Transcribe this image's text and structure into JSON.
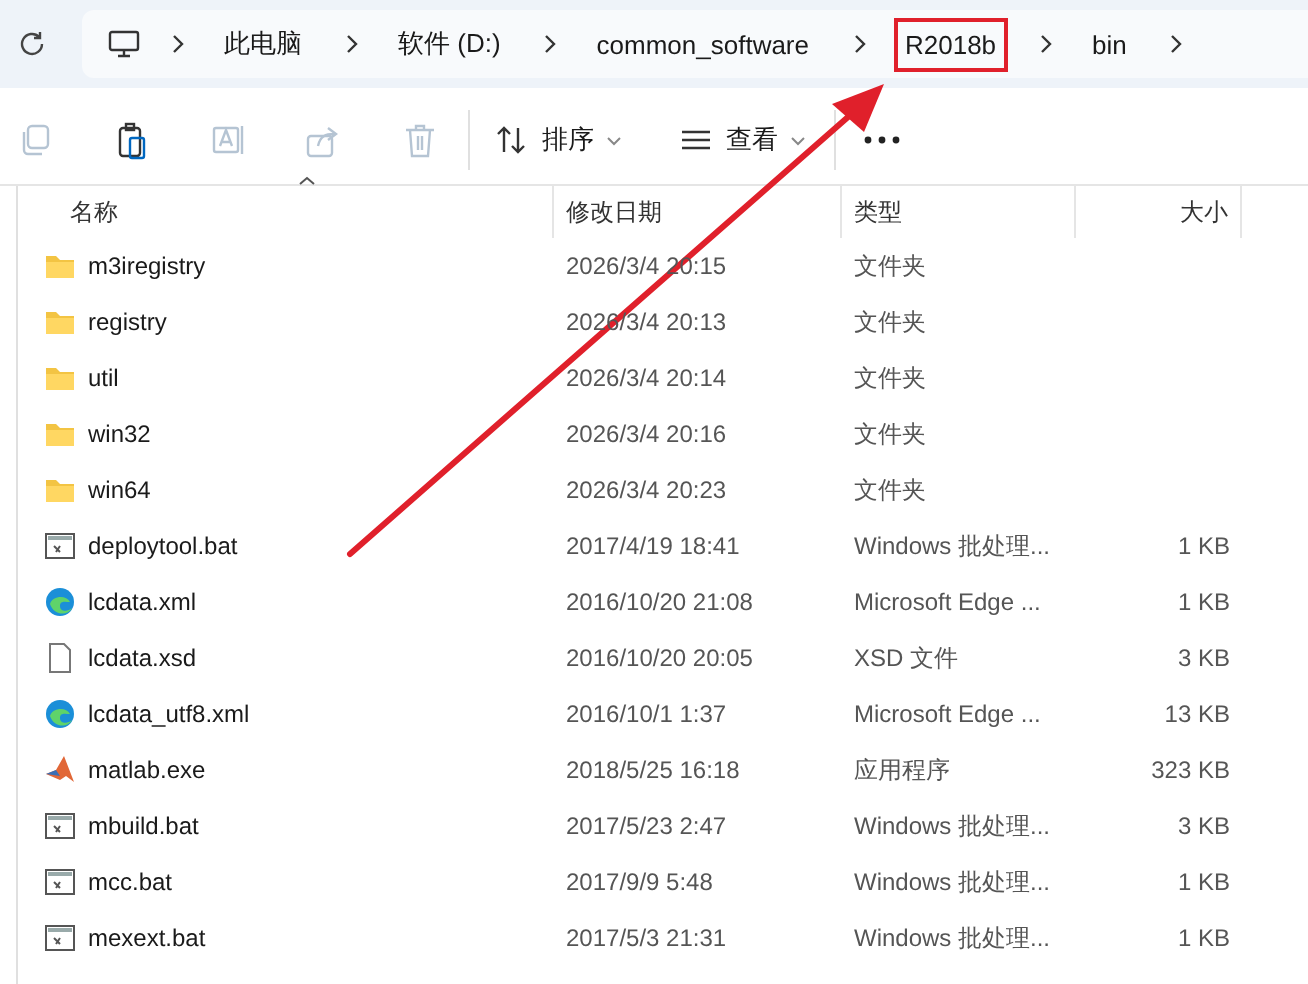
{
  "breadcrumb": [
    {
      "label": "此电脑",
      "highlighted": false
    },
    {
      "label": "软件 (D:)",
      "highlighted": false
    },
    {
      "label": "common_software",
      "highlighted": false
    },
    {
      "label": "R2018b",
      "highlighted": true
    },
    {
      "label": "bin",
      "highlighted": false
    }
  ],
  "toolbar": {
    "actions": [
      {
        "kind": "copy",
        "disabled": true
      },
      {
        "kind": "paste",
        "disabled": false
      },
      {
        "kind": "rename",
        "disabled": true
      },
      {
        "kind": "share",
        "disabled": true
      },
      {
        "kind": "delete",
        "disabled": true
      }
    ],
    "sort_label": "排序",
    "view_label": "查看"
  },
  "table": {
    "columns": [
      "名称",
      "修改日期",
      "类型",
      "大小"
    ],
    "rows": [
      {
        "kind": "folder",
        "name": "m3iregistry",
        "date": "2026/3/4 20:15",
        "type": "文件夹",
        "size": ""
      },
      {
        "kind": "folder",
        "name": "registry",
        "date": "2026/3/4 20:13",
        "type": "文件夹",
        "size": ""
      },
      {
        "kind": "folder",
        "name": "util",
        "date": "2026/3/4 20:14",
        "type": "文件夹",
        "size": ""
      },
      {
        "kind": "folder",
        "name": "win32",
        "date": "2026/3/4 20:16",
        "type": "文件夹",
        "size": ""
      },
      {
        "kind": "folder",
        "name": "win64",
        "date": "2026/3/4 20:23",
        "type": "文件夹",
        "size": ""
      },
      {
        "kind": "batch",
        "name": "deploytool.bat",
        "date": "2017/4/19 18:41",
        "type": "Windows 批处理...",
        "size": "1 KB"
      },
      {
        "kind": "edge",
        "name": "lcdata.xml",
        "date": "2016/10/20 21:08",
        "type": "Microsoft Edge ...",
        "size": "1 KB"
      },
      {
        "kind": "file",
        "name": "lcdata.xsd",
        "date": "2016/10/20 20:05",
        "type": "XSD 文件",
        "size": "3 KB"
      },
      {
        "kind": "edge",
        "name": "lcdata_utf8.xml",
        "date": "2016/10/1 1:37",
        "type": "Microsoft Edge ...",
        "size": "13 KB"
      },
      {
        "kind": "matlab",
        "name": "matlab.exe",
        "date": "2018/5/25 16:18",
        "type": "应用程序",
        "size": "323 KB"
      },
      {
        "kind": "batch",
        "name": "mbuild.bat",
        "date": "2017/5/23 2:47",
        "type": "Windows 批处理...",
        "size": "3 KB"
      },
      {
        "kind": "batch",
        "name": "mcc.bat",
        "date": "2017/9/9 5:48",
        "type": "Windows 批处理...",
        "size": "1 KB"
      },
      {
        "kind": "batch",
        "name": "mexext.bat",
        "date": "2017/5/3 21:31",
        "type": "Windows 批处理...",
        "size": "1 KB"
      }
    ]
  }
}
